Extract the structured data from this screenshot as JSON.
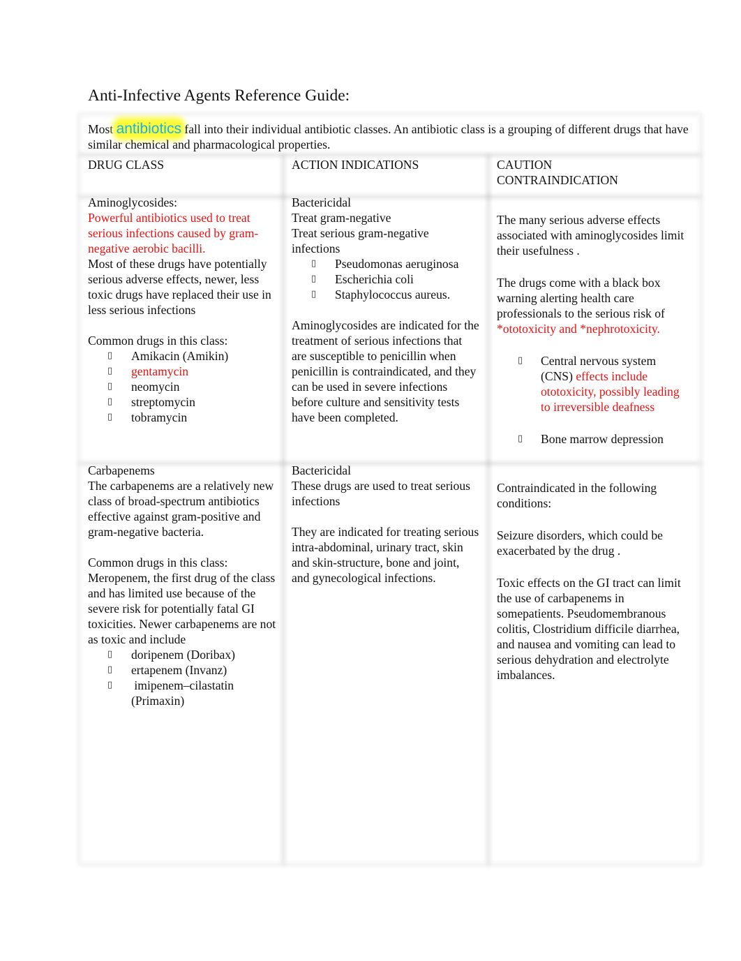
{
  "document": {
    "title": "Anti-Infective Agents Reference Guide:",
    "intro": {
      "prefix": "Most ",
      "highlight": "antibiotics",
      "suffix": " fall into their individual antibiotic classes. An antibiotic class is a grouping of different drugs that have similar chemical and pharmacological properties."
    },
    "colors": {
      "emphasis_red": "#ee1111",
      "highlight_text": "#18b3e6",
      "highlight_bg": "#fbfb3a"
    },
    "headers": {
      "drug_class": "DRUG CLASS",
      "action": "ACTION INDICATIONS",
      "caution_line1": "CAUTION",
      "caution_line2": "CONTRAINDICATION"
    },
    "bullet_glyph": "▯",
    "rows": [
      {
        "drug_class": {
          "name": "Aminoglycosides:",
          "summary_red": "Powerful antibiotics used to treat serious infections caused by gram-negative aerobic bacilli.",
          "description": "Most of these drugs have potentially serious adverse effects, newer, less toxic drugs have replaced their use in less serious infections",
          "common_label": "Common drugs in this class:",
          "drugs": [
            {
              "name": "Amikacin (Amikin)",
              "red": false
            },
            {
              "name": "gentamycin",
              "red": true
            },
            {
              "name": "neomycin",
              "red": false
            },
            {
              "name": "streptomycin",
              "red": false
            },
            {
              "name": "tobramycin",
              "red": false
            }
          ]
        },
        "action": {
          "type": "Bactericidal",
          "line1": "Treat gram-negative",
          "line2": "Treat serious gram-negative infections",
          "organisms": [
            "Pseudomonas aeruginosa",
            "Escherichia coli",
            "Staphylococcus aureus."
          ],
          "indication": "Aminoglycosides are indicated for the treatment of serious infections that are susceptible to penicillin when penicillin is contraindicated, and they can be used in severe infections before culture and sensitivity tests have been completed."
        },
        "caution": {
          "p1": "The many serious adverse effects associated with aminoglycosides limit their usefulness  .",
          "p2": "The drugs come with a black box warning alerting health care professionals to the serious risk of ",
          "p2_red": "*ototoxicity and *nephrotoxicity.",
          "effects": [
            {
              "black": "Central nervous system (CNS) ",
              "red": "effects include ototoxicity, possibly leading to irreversible deafness"
            },
            {
              "black": "Bone marrow depression",
              "red": ""
            }
          ]
        }
      },
      {
        "drug_class": {
          "name": "Carbapenems",
          "description": "The carbapenems are a relatively new class of broad-spectrum antibiotics effective against gram-positive and gram-negative bacteria.",
          "common_label": "Common drugs in this class:",
          "common_text": "Meropenem, the first drug of the class and has limited use because of the severe risk for potentially fatal GI toxicities. Newer carbapenems are not as toxic and include",
          "drugs": [
            "doripenem (Doribax)",
            "ertapenem (Invanz)",
            " imipenem–cilastatin (Primaxin)"
          ]
        },
        "action": {
          "type": "Bactericidal",
          "line1": "These drugs are used to treat serious infections",
          "indication": "They are indicated for treating serious intra-abdominal, urinary tract, skin and skin-structure, bone and joint, and gynecological infections."
        },
        "caution": {
          "p1": "Contraindicated in the following conditions:",
          "p2": "Seizure disorders, which could be exacerbated by the drug .",
          "p3": "Toxic effects on the GI tract can limit the use of carbapenems in somepatients. Pseudomembranous colitis, Clostridium difficile diarrhea, and nausea and vomiting can lead to serious dehydration and electrolyte imbalances."
        }
      }
    ]
  }
}
